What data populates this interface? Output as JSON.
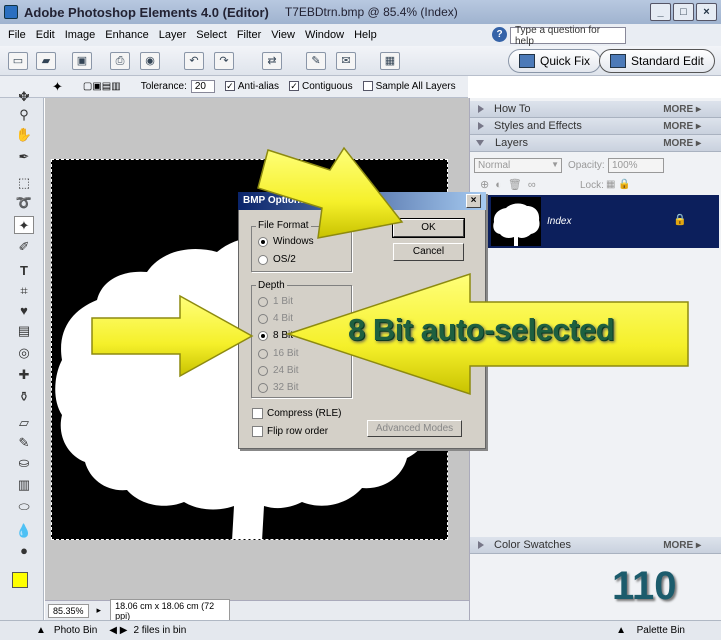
{
  "window": {
    "app_title": "Adobe Photoshop Elements 4.0 (Editor)",
    "doc_title": "T7EBDtrn.bmp @ 85.4% (Index)",
    "min_label": "_",
    "max_label": "□",
    "close_label": "×"
  },
  "menu": {
    "items": [
      "File",
      "Edit",
      "Image",
      "Enhance",
      "Layer",
      "Select",
      "Filter",
      "View",
      "Window",
      "Help"
    ],
    "help_placeholder": "Type a question for help",
    "help_icon": "?"
  },
  "modes": {
    "quick_fix": "Quick Fix",
    "standard_edit": "Standard Edit"
  },
  "options_bar": {
    "tolerance_label": "Tolerance:",
    "tolerance_value": "20",
    "anti_alias": "Anti-alias",
    "contiguous": "Contiguous",
    "sample_all": "Sample All Layers",
    "anti_alias_checked": true,
    "contiguous_checked": true,
    "sample_all_checked": false
  },
  "palettes": {
    "how_to": "How To",
    "styles": "Styles and Effects",
    "layers": "Layers",
    "swatches": "Color Swatches",
    "more": "MORE",
    "blend_mode": "Normal",
    "opacity_label": "Opacity:",
    "opacity_value": "100%",
    "lock_label": "Lock:",
    "layer_name": "Index"
  },
  "status": {
    "zoom": "85.35%",
    "size": "18.06 cm x 18.06 cm (72 ppi)"
  },
  "bottom": {
    "photo_bin": "Photo Bin",
    "files_in_bin": "2 files in bin",
    "palette_bin": "Palette Bin"
  },
  "dialog": {
    "title": "BMP Options",
    "file_format_label": "File Format",
    "windows": "Windows",
    "os2": "OS/2",
    "depth_label": "Depth",
    "depths": [
      "1 Bit",
      "4 Bit",
      "8 Bit",
      "16 Bit",
      "24 Bit",
      "32 Bit"
    ],
    "selected_depth": "8 Bit",
    "compress": "Compress (RLE)",
    "flip": "Flip row order",
    "ok": "OK",
    "cancel": "Cancel",
    "advanced": "Advanced Modes"
  },
  "callout": {
    "text": "8 Bit auto-selected"
  },
  "page_number": "110",
  "colors": {
    "arrow_fill": "#f5f02a",
    "callout_text": "#1e6040",
    "layer_selected": "#0c1f5c",
    "dialog_title": "#0a246a"
  }
}
